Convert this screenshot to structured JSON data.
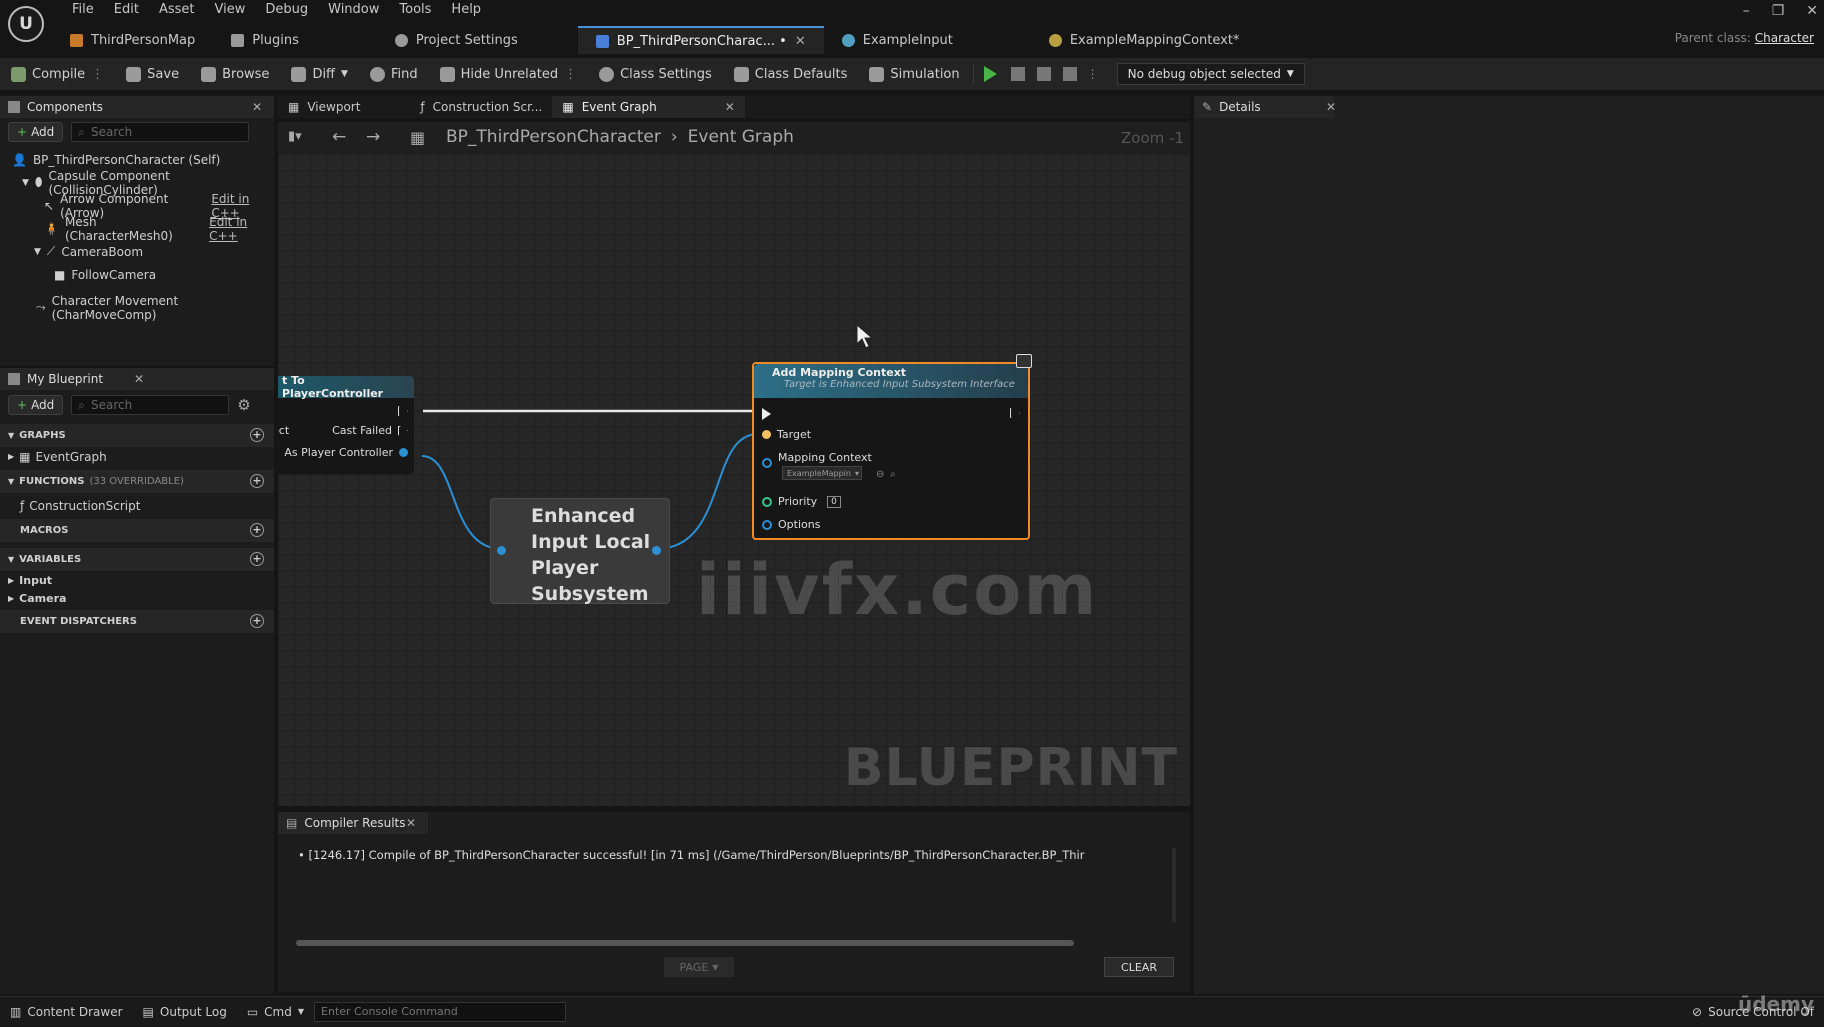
{
  "menu": {
    "items": [
      "File",
      "Edit",
      "Asset",
      "View",
      "Debug",
      "Window",
      "Tools",
      "Help"
    ]
  },
  "doc_tabs": [
    {
      "label": "ThirdPersonMap",
      "icon": "level-icon",
      "color": "#c77a2a"
    },
    {
      "label": "Plugins",
      "icon": "plugin-icon",
      "color": "#9a9a9a"
    },
    {
      "label": "Project Settings",
      "icon": "settings-icon",
      "color": "#9a9a9a"
    },
    {
      "label": "BP_ThirdPersonCharac... •",
      "icon": "blueprint-icon",
      "color": "#4a7fd9",
      "active": true
    },
    {
      "label": "ExampleInput",
      "icon": "input-action-icon",
      "color": "#4fa0c0"
    },
    {
      "label": "ExampleMappingContext*",
      "icon": "mapping-context-icon",
      "color": "#b8a040"
    }
  ],
  "parent_class": {
    "label": "Parent class:",
    "value": "Character"
  },
  "toolbar": {
    "compile": "Compile",
    "save": "Save",
    "browse": "Browse",
    "diff": "Diff",
    "find": "Find",
    "hide_unrelated": "Hide Unrelated",
    "class_settings": "Class Settings",
    "class_defaults": "Class Defaults",
    "simulation": "Simulation",
    "debug_select": "No debug object selected"
  },
  "components": {
    "title": "Components",
    "add": "Add",
    "search_placeholder": "Search",
    "self": "BP_ThirdPersonCharacter (Self)",
    "capsule": "Capsule Component (CollisionCylinder)",
    "arrow": "Arrow Component (Arrow)",
    "mesh": "Mesh (CharacterMesh0)",
    "edit_cpp": "Edit in C++",
    "boom": "CameraBoom",
    "camera": "FollowCamera",
    "movement": "Character Movement (CharMoveComp)"
  },
  "my_blueprint": {
    "title": "My Blueprint",
    "add": "Add",
    "search_placeholder": "Search",
    "graphs": "GRAPHS",
    "event_graph": "EventGraph",
    "functions": "FUNCTIONS",
    "functions_count": "(33 OVERRIDABLE)",
    "construction": "ConstructionScript",
    "macros": "MACROS",
    "variables": "VARIABLES",
    "var_input": "Input",
    "var_camera": "Camera",
    "dispatchers": "EVENT DISPATCHERS"
  },
  "editor_tabs": {
    "viewport": "Viewport",
    "construction": "Construction Scr...",
    "event_graph": "Event Graph"
  },
  "breadcrumb": {
    "root": "BP_ThirdPersonCharacter",
    "leaf": "Event Graph",
    "zoom": "Zoom -1"
  },
  "nodes": {
    "cast": {
      "title": "t To PlayerController",
      "pin_object": "ect",
      "cast_failed": "Cast Failed",
      "as_pc": "As Player Controller"
    },
    "subsystem": {
      "title": "Enhanced Input Local Player Subsystem"
    },
    "mapping": {
      "title": "Add Mapping Context",
      "subtitle": "Target is Enhanced Input Subsystem Interface",
      "target": "Target",
      "mapping_context": "Mapping Context",
      "mapping_value": "ExampleMappin",
      "priority": "Priority",
      "priority_value": "0",
      "options": "Options"
    }
  },
  "watermark": "iiivfx.com",
  "graph_watermark": "BLUEPRINT",
  "details": {
    "title": "Details"
  },
  "compiler": {
    "title": "Compiler Results",
    "message": "[1246.17] Compile of BP_ThirdPersonCharacter successful! [in 71 ms] (/Game/ThirdPerson/Blueprints/BP_ThirdPersonCharacter.BP_Thir",
    "page": "PAGE",
    "clear": "CLEAR"
  },
  "statusbar": {
    "content_drawer": "Content Drawer",
    "output_log": "Output Log",
    "cmd": "Cmd",
    "console_placeholder": "Enter Console Command",
    "source_control": "Source Control Of"
  },
  "udemy": "ūdemy"
}
